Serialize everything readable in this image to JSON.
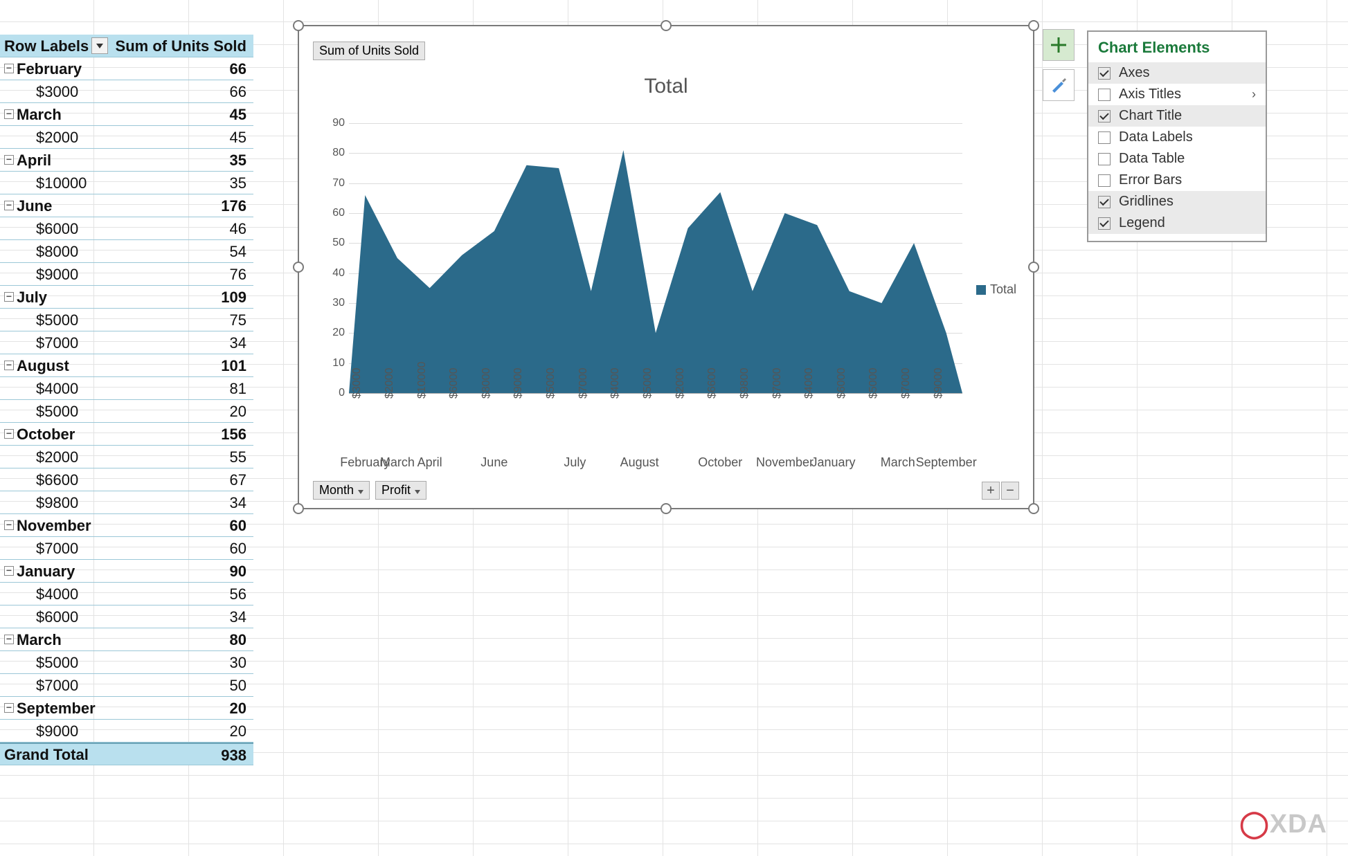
{
  "pivot": {
    "headers": {
      "a": "Row Labels",
      "b": "Sum of Units Sold"
    },
    "groups": [
      {
        "label": "February",
        "value": 66,
        "children": [
          {
            "label": "$3000",
            "value": 66
          }
        ]
      },
      {
        "label": "March",
        "value": 45,
        "children": [
          {
            "label": "$2000",
            "value": 45
          }
        ]
      },
      {
        "label": "April",
        "value": 35,
        "children": [
          {
            "label": "$10000",
            "value": 35
          }
        ]
      },
      {
        "label": "June",
        "value": 176,
        "children": [
          {
            "label": "$6000",
            "value": 46
          },
          {
            "label": "$8000",
            "value": 54
          },
          {
            "label": "$9000",
            "value": 76
          }
        ]
      },
      {
        "label": "July",
        "value": 109,
        "children": [
          {
            "label": "$5000",
            "value": 75
          },
          {
            "label": "$7000",
            "value": 34
          }
        ]
      },
      {
        "label": "August",
        "value": 101,
        "children": [
          {
            "label": "$4000",
            "value": 81
          },
          {
            "label": "$5000",
            "value": 20
          }
        ]
      },
      {
        "label": "October",
        "value": 156,
        "children": [
          {
            "label": "$2000",
            "value": 55
          },
          {
            "label": "$6600",
            "value": 67
          },
          {
            "label": "$9800",
            "value": 34
          }
        ]
      },
      {
        "label": "November",
        "value": 60,
        "children": [
          {
            "label": "$7000",
            "value": 60
          }
        ]
      },
      {
        "label": "January",
        "value": 90,
        "children": [
          {
            "label": "$4000",
            "value": 56
          },
          {
            "label": "$6000",
            "value": 34
          }
        ]
      },
      {
        "label": "March",
        "value": 80,
        "children": [
          {
            "label": "$5000",
            "value": 30
          },
          {
            "label": "$7000",
            "value": 50
          }
        ]
      },
      {
        "label": "September",
        "value": 20,
        "children": [
          {
            "label": "$9000",
            "value": 20
          }
        ]
      }
    ],
    "grand_total_label": "Grand Total",
    "grand_total_value": 938
  },
  "chart": {
    "field_button": "Sum of Units Sold",
    "title": "Total",
    "legend": "Total",
    "filter_month": "Month",
    "filter_profit": "Profit"
  },
  "chart_data": {
    "type": "area",
    "title": "Total",
    "ylabel": "",
    "xlabel": "",
    "ylim": [
      0,
      90
    ],
    "yticks": [
      0,
      10,
      20,
      30,
      40,
      50,
      60,
      70,
      80,
      90
    ],
    "series": [
      {
        "name": "Total",
        "color": "#2b6a8a",
        "values": [
          66,
          45,
          35,
          46,
          54,
          76,
          75,
          34,
          81,
          20,
          55,
          67,
          34,
          60,
          56,
          34,
          30,
          50,
          20
        ]
      }
    ],
    "x_secondary": [
      "$3000",
      "$2000",
      "$10000",
      "$6000",
      "$8000",
      "$9000",
      "$5000",
      "$7000",
      "$4000",
      "$5000",
      "$2000",
      "$6600",
      "$9800",
      "$7000",
      "$4000",
      "$6000",
      "$5000",
      "$7000",
      "$9000"
    ],
    "x_primary_groups": [
      {
        "label": "February",
        "span": 1
      },
      {
        "label": "March",
        "span": 1
      },
      {
        "label": "April",
        "span": 1
      },
      {
        "label": "June",
        "span": 3
      },
      {
        "label": "July",
        "span": 2
      },
      {
        "label": "August",
        "span": 2
      },
      {
        "label": "October",
        "span": 3
      },
      {
        "label": "November",
        "span": 1
      },
      {
        "label": "January",
        "span": 2
      },
      {
        "label": "March",
        "span": 2
      },
      {
        "label": "September",
        "span": 1
      }
    ]
  },
  "flyout": {
    "title": "Chart Elements",
    "items": [
      {
        "label": "Axes",
        "checked": true,
        "highlighted": true,
        "expandable": false
      },
      {
        "label": "Axis Titles",
        "checked": false,
        "highlighted": false,
        "expandable": true
      },
      {
        "label": "Chart Title",
        "checked": true,
        "highlighted": true,
        "expandable": false
      },
      {
        "label": "Data Labels",
        "checked": false,
        "highlighted": false,
        "expandable": false
      },
      {
        "label": "Data Table",
        "checked": false,
        "highlighted": false,
        "expandable": false
      },
      {
        "label": "Error Bars",
        "checked": false,
        "highlighted": false,
        "expandable": false
      },
      {
        "label": "Gridlines",
        "checked": true,
        "highlighted": true,
        "expandable": false
      },
      {
        "label": "Legend",
        "checked": true,
        "highlighted": true,
        "expandable": false
      }
    ]
  },
  "logo": {
    "text": "XDA"
  }
}
